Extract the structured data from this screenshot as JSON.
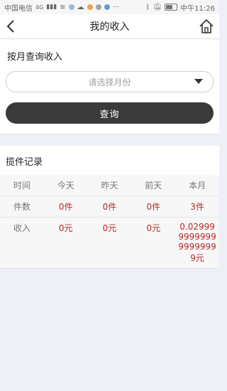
{
  "status_bar": {
    "carrier": "中国电信",
    "network": "4G",
    "time": "中午11:26"
  },
  "header": {
    "title": "我的收入"
  },
  "query": {
    "section_title": "按月查询收入",
    "month_placeholder": "请选择月份",
    "query_button": "查询"
  },
  "records": {
    "title": "揽件记录",
    "columns": [
      "时间",
      "今天",
      "昨天",
      "前天",
      "本月"
    ],
    "rows": [
      {
        "label": "件数",
        "values": [
          "0件",
          "0件",
          "0件",
          "3件"
        ]
      },
      {
        "label": "收入",
        "values": [
          "0元",
          "0元",
          "0元",
          "0.02999999999999999999元"
        ]
      }
    ]
  },
  "colors": {
    "accent_value": "#b22a2a",
    "button_bg": "#3a3a3a",
    "page_bg": "#eef0f7"
  }
}
